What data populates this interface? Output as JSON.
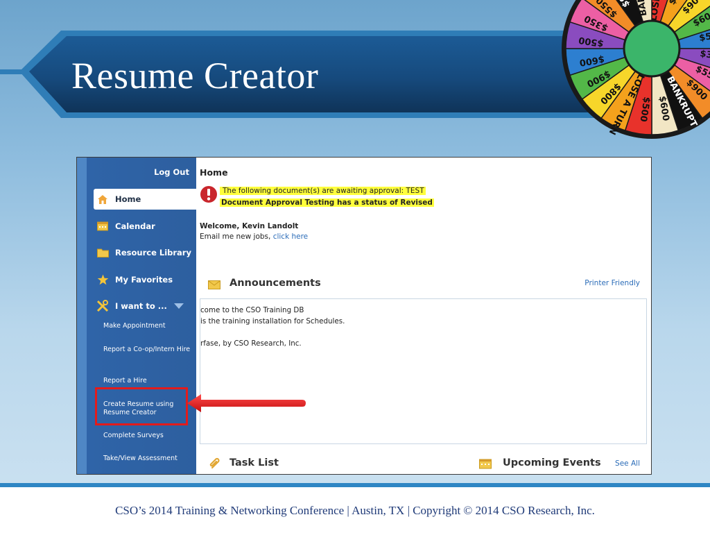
{
  "slide": {
    "title": "Resume Creator",
    "footer": "CSO’s 2014 Training & Networking Conference   |   Austin, TX   |  Copyright © 2014 CSO Research, Inc."
  },
  "app": {
    "sidebar": {
      "logout_label": "Log Out",
      "items": [
        {
          "label": "Home",
          "icon": "house-icon",
          "active": true
        },
        {
          "label": "Calendar",
          "icon": "calendar-icon"
        },
        {
          "label": "Resource Library",
          "icon": "folder-icon"
        },
        {
          "label": "My Favorites",
          "icon": "star-icon"
        },
        {
          "label": "I want to ...",
          "icon": "tools-icon"
        }
      ],
      "sub_items": [
        "Make Appointment",
        "Report a Co-op/Intern Hire",
        "Report a Hire",
        "Create Resume using Resume Creator",
        "Complete Surveys",
        "Take/View Assessment"
      ],
      "highlighted_item": "Create Resume using Resume Creator"
    },
    "main": {
      "page_title": "Home",
      "alerts": [
        "The following document(s) are awaiting approval: TEST",
        "Document Approval Testing has a status of Revised"
      ],
      "welcome": "Welcome, Kevin Landolt",
      "email_text": "Email me new jobs, ",
      "email_link": "click here",
      "announcements": {
        "title": "Announcements",
        "printer_link": "Printer Friendly",
        "lines": [
          "come to the CSO Training DB",
          " is the training installation for Schedules.",
          "rfase, by CSO Research, Inc."
        ]
      },
      "task_list_title": "Task List",
      "upcoming_events_title": "Upcoming Events",
      "see_all_link": "See All"
    }
  },
  "wheel": {
    "segment_labels": [
      "LOSE A TURN",
      "$800",
      "$900",
      "$600",
      "$500",
      "$350",
      "$550",
      "$900",
      "BANKRUPT",
      "$600",
      "$500"
    ],
    "colors": [
      "#e8322b",
      "#f4a11c",
      "#f7d62a",
      "#53b848",
      "#2d7fd0",
      "#8a4cbf",
      "#ec5fa4",
      "#f28c28",
      "#111111",
      "#f2e6c4"
    ]
  },
  "colors": {
    "banner_dark": "#133a66",
    "banner_mid": "#1d5a94",
    "sidebar": "#2f64a8",
    "highlight": "#e31b1b",
    "alert_bg": "#ffff3c",
    "link": "#2b6cb8"
  }
}
